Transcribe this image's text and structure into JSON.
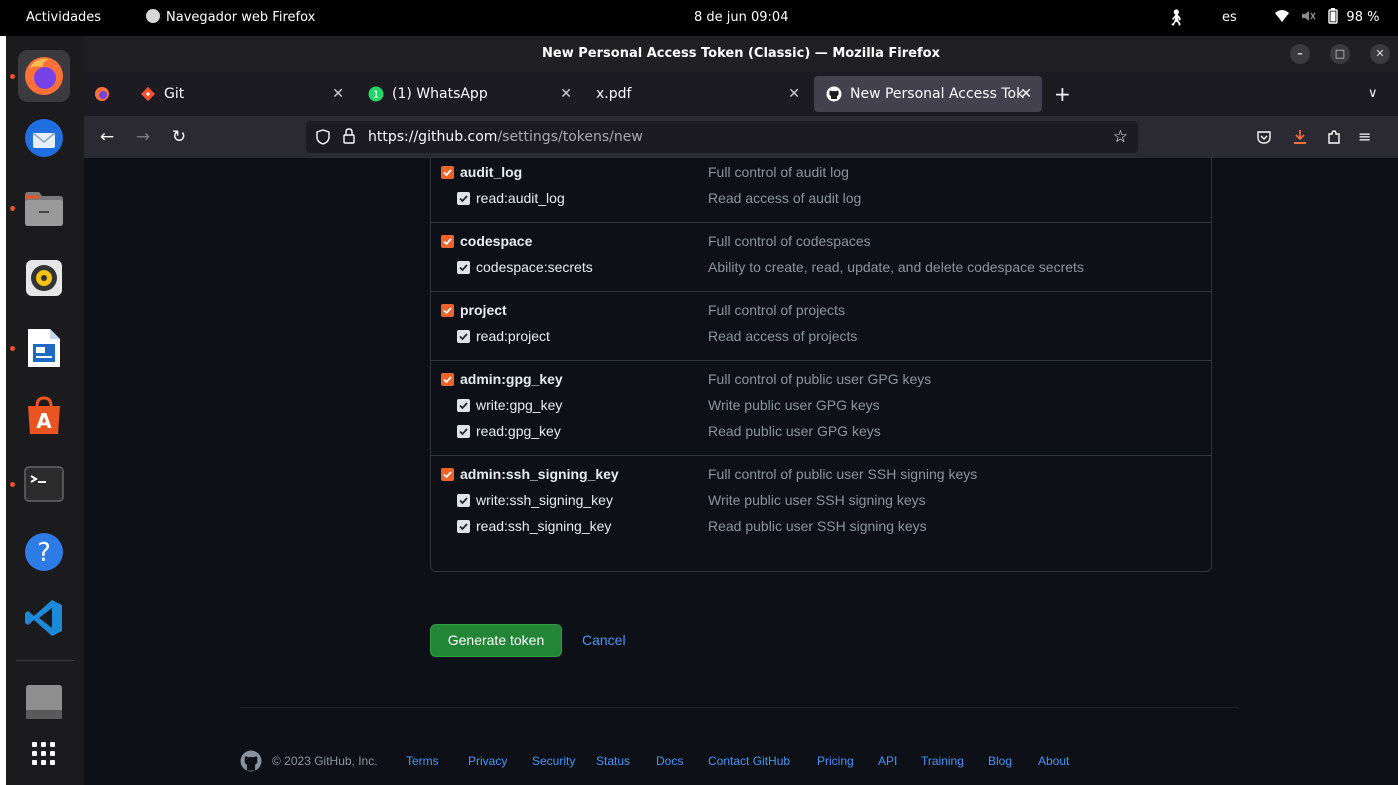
{
  "topbar": {
    "activities": "Actividades",
    "app_name": "Navegador web Firefox",
    "clock": "8 de jun  09:04",
    "lang": "es",
    "battery": "98 %"
  },
  "dock": {
    "apps": [
      {
        "name": "firefox",
        "running": true
      },
      {
        "name": "thunderbird",
        "running": false
      },
      {
        "name": "files",
        "running": true
      },
      {
        "name": "rhythmbox",
        "running": false
      },
      {
        "name": "libreoffice-writer",
        "running": true
      },
      {
        "name": "app-center",
        "running": false
      },
      {
        "name": "terminal",
        "running": true
      },
      {
        "name": "help",
        "running": false
      },
      {
        "name": "vscode",
        "running": false
      },
      {
        "name": "drive",
        "running": false
      },
      {
        "name": "show-apps",
        "running": false
      }
    ]
  },
  "window": {
    "title": "New Personal Access Token (Classic) — Mozilla Firefox"
  },
  "tabs": [
    {
      "label": "Git",
      "icon": "git-icon",
      "active": false
    },
    {
      "label": "(1) WhatsApp",
      "icon": "whatsapp-icon",
      "active": false
    },
    {
      "label": "x.pdf",
      "icon": "",
      "active": false
    },
    {
      "label": "New Personal Access Tok",
      "icon": "github-icon",
      "active": true
    }
  ],
  "navbar": {
    "url_domain": "https://github.com",
    "url_path": "/settings/tokens/new"
  },
  "scopes": [
    {
      "name": "audit_log",
      "desc": "Full control of audit log",
      "children": [
        {
          "name": "read:audit_log",
          "desc": "Read access of audit log"
        }
      ]
    },
    {
      "name": "codespace",
      "desc": "Full control of codespaces",
      "children": [
        {
          "name": "codespace:secrets",
          "desc": "Ability to create, read, update, and delete codespace secrets"
        }
      ]
    },
    {
      "name": "project",
      "desc": "Full control of projects",
      "children": [
        {
          "name": "read:project",
          "desc": "Read access of projects"
        }
      ]
    },
    {
      "name": "admin:gpg_key",
      "desc": "Full control of public user GPG keys",
      "children": [
        {
          "name": "write:gpg_key",
          "desc": "Write public user GPG keys"
        },
        {
          "name": "read:gpg_key",
          "desc": "Read public user GPG keys"
        }
      ]
    },
    {
      "name": "admin:ssh_signing_key",
      "desc": "Full control of public user SSH signing keys",
      "children": [
        {
          "name": "write:ssh_signing_key",
          "desc": "Write public user SSH signing keys"
        },
        {
          "name": "read:ssh_signing_key",
          "desc": "Read public user SSH signing keys"
        }
      ]
    }
  ],
  "actions": {
    "generate": "Generate token",
    "cancel": "Cancel"
  },
  "footer": {
    "copyright": "© 2023 GitHub, Inc.",
    "links": [
      "Terms",
      "Privacy",
      "Security",
      "Status",
      "Docs",
      "Contact GitHub",
      "Pricing",
      "API",
      "Training",
      "Blog",
      "About"
    ]
  },
  "colors": {
    "page_bg": "#0d1117",
    "checkbox_accent": "#f0642a",
    "primary_button": "#238636",
    "link": "#4493f8"
  }
}
